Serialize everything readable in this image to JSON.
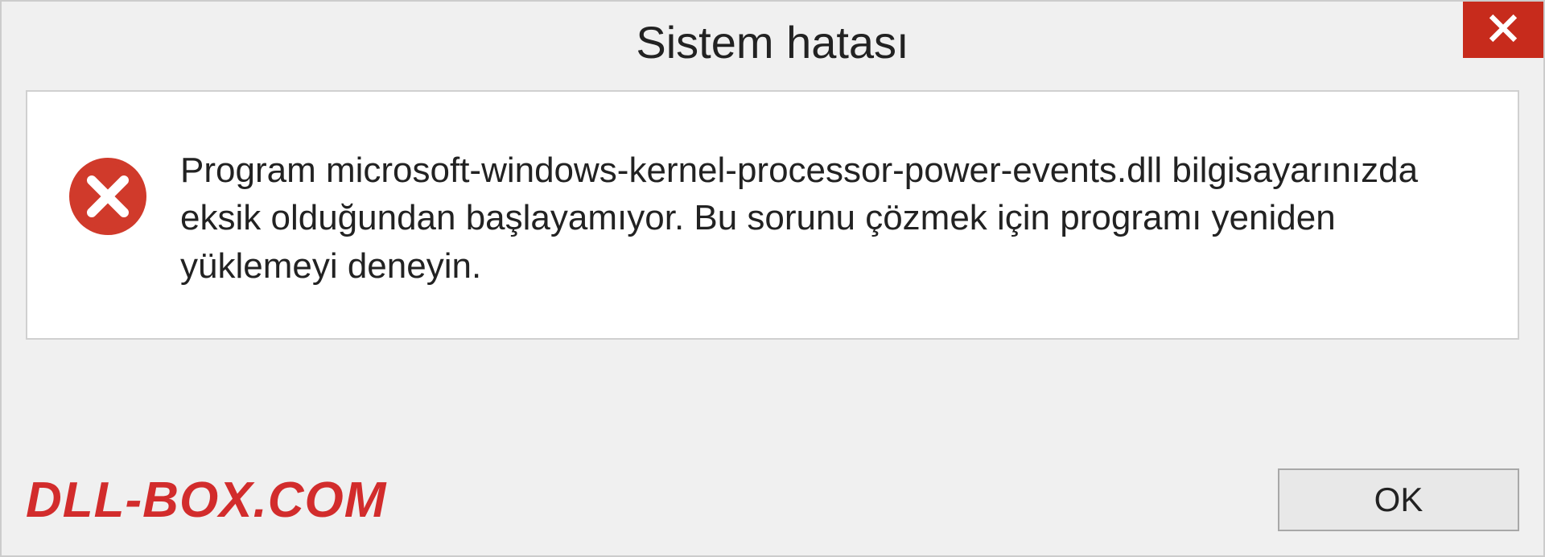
{
  "titlebar": {
    "title": "Sistem hatası"
  },
  "content": {
    "message": "Program microsoft-windows-kernel-processor-power-events.dll bilgisayarınızda eksik olduğundan başlayamıyor. Bu sorunu çözmek için programı yeniden yüklemeyi deneyin."
  },
  "footer": {
    "watermark": "DLL-BOX.COM",
    "ok_label": "OK"
  },
  "colors": {
    "close_button_bg": "#c72b1c",
    "error_icon_bg": "#d03a2b",
    "watermark_color": "#d22c2c"
  }
}
